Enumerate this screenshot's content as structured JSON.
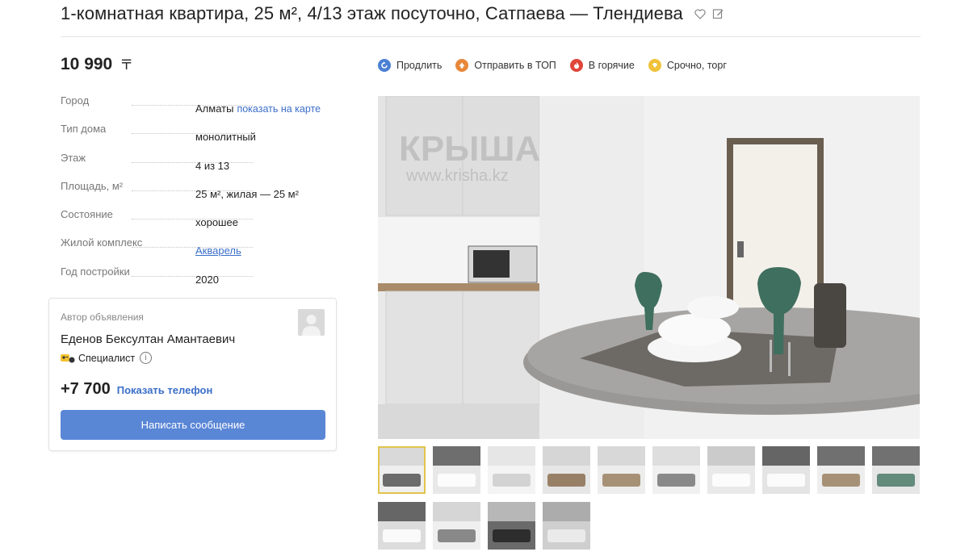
{
  "title": "1-комнатная квартира, 25 м², 4/13 этаж посуточно, Сатпаева — Тлендиева",
  "title_icons": [
    "heart-icon",
    "edit-note-icon"
  ],
  "price": {
    "value": "10 990",
    "currency": "〒"
  },
  "params": [
    {
      "label": "Город",
      "value": "Алматы",
      "link": "показать на карте"
    },
    {
      "label": "Тип дома",
      "value": "монолитный"
    },
    {
      "label": "Этаж",
      "value": "4 из 13"
    },
    {
      "label": "Площадь, м²",
      "value": "25 м², жилая — 25 м²"
    },
    {
      "label": "Состояние",
      "value": "хорошее"
    },
    {
      "label": "Жилой комплекс",
      "value": "Акварель"
    },
    {
      "label": "Год постройки",
      "value": "2020"
    }
  ],
  "author": {
    "label": "Автор объявления",
    "name": "Еденов Бексултан Амантаевич",
    "role": "Специалист",
    "info_glyph": "i",
    "phone": "+7 700",
    "show_phone": "Показать телефон",
    "message_button": "Написать сообщение"
  },
  "actions": [
    {
      "label": "Продлить",
      "icon": "renew-icon",
      "color": "#4a7fd4"
    },
    {
      "label": "Отправить в ТОП",
      "icon": "top-arrow-icon",
      "color": "#e8883a"
    },
    {
      "label": "В горячие",
      "icon": "fire-icon",
      "color": "#e0463a"
    },
    {
      "label": "Срочно, торг",
      "icon": "urgent-icon",
      "color": "#f0c23a"
    }
  ],
  "watermark": {
    "logo": "КРЫША",
    "url": "www.krisha.kz"
  },
  "thumbnails": {
    "count": 14,
    "active_index": 0
  }
}
